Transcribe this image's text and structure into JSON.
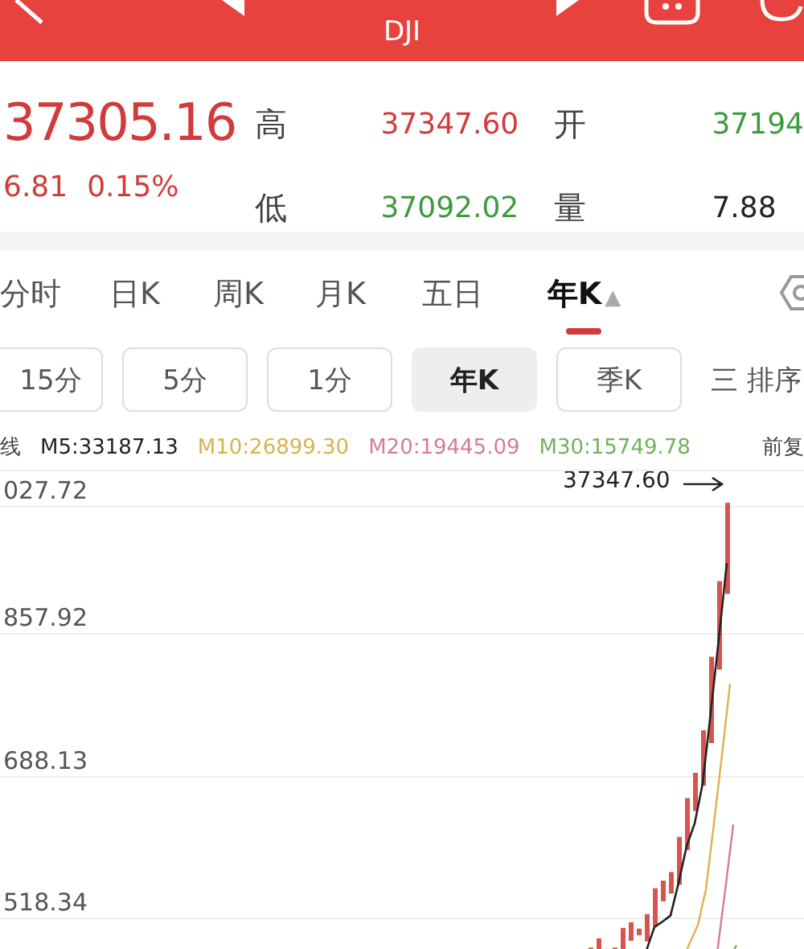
{
  "header": {
    "title": "DJI"
  },
  "quote": {
    "price": "37305.16",
    "change": "6.81",
    "change_pct": "0.15%",
    "color": "#d23b3b",
    "stats": [
      {
        "label": "高",
        "value": "37347.60",
        "color": "#d23b3b"
      },
      {
        "label": "开",
        "value": "37194",
        "color": "#3f9a3f"
      },
      {
        "label": "低",
        "value": "37092.02",
        "color": "#3f9a3f"
      },
      {
        "label": "量",
        "value": "7.88",
        "color": "#222222"
      }
    ]
  },
  "period_tabs": [
    {
      "label": "分时",
      "selected": false
    },
    {
      "label": "日K",
      "selected": false
    },
    {
      "label": "周K",
      "selected": false
    },
    {
      "label": "月K",
      "selected": false
    },
    {
      "label": "五日",
      "selected": false
    },
    {
      "label": "年K",
      "selected": true,
      "caret": "▲"
    }
  ],
  "sub_periods": [
    {
      "label": "15分",
      "selected": false
    },
    {
      "label": "5分",
      "selected": false
    },
    {
      "label": "1分",
      "selected": false
    },
    {
      "label": "年K",
      "selected": true
    },
    {
      "label": "季K",
      "selected": false
    }
  ],
  "sort_button": {
    "icon": "三",
    "label": "排序"
  },
  "ma_bar": {
    "label": "线",
    "items": [
      {
        "text": "M5:33187.13",
        "color": "#222222"
      },
      {
        "text": "M10:26899.30",
        "color": "#d9b24a"
      },
      {
        "text": "M20:19445.09",
        "color": "#d67a97"
      },
      {
        "text": "M30:15749.78",
        "color": "#6fb35a"
      }
    ],
    "adjust": "前复"
  },
  "chart": {
    "y_labels": [
      "027.72",
      "857.92",
      "688.13",
      "518.34"
    ],
    "high_label": "37347.60"
  }
}
